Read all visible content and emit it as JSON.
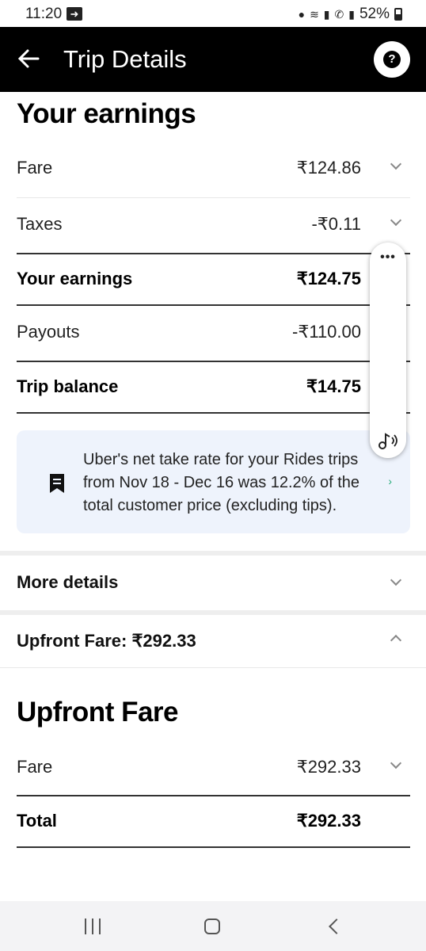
{
  "status_bar": {
    "time": "11:20",
    "battery": "52%"
  },
  "header": {
    "title": "Trip Details"
  },
  "earnings": {
    "title": "Your earnings",
    "rows": [
      {
        "label": "Fare",
        "value": "₹124.86"
      },
      {
        "label": "Taxes",
        "value": "-₹0.11"
      },
      {
        "label": "Your earnings",
        "value": "₹124.75"
      },
      {
        "label": "Payouts",
        "value": "-₹110.00"
      },
      {
        "label": "Trip balance",
        "value": "₹14.75"
      }
    ]
  },
  "info_card": {
    "text": "Uber's net take rate for your Rides trips from Nov 18 - Dec 16 was 12.2% of the total customer price (excluding tips)."
  },
  "more_details": {
    "label": "More details"
  },
  "upfront_toggle": {
    "label": "Upfront Fare: ₹292.33"
  },
  "upfront": {
    "title": "Upfront Fare",
    "rows": [
      {
        "label": "Fare",
        "value": "₹292.33"
      },
      {
        "label": "Total",
        "value": "₹292.33"
      }
    ]
  },
  "float_widget": {
    "dots": "•••"
  }
}
